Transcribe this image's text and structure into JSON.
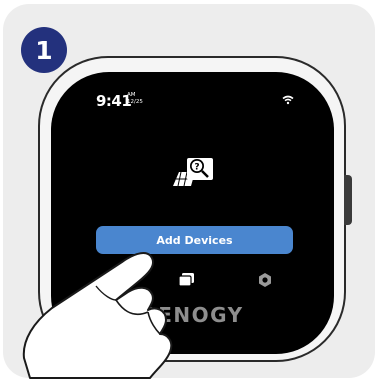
{
  "step": {
    "number": "1"
  },
  "status_bar": {
    "time": "9:41",
    "ampm": "AM",
    "date": "12/25",
    "wifi_icon": "wifi-icon"
  },
  "main": {
    "illustration_icon": "device-search-icon",
    "add_button_label": "Add Devices"
  },
  "nav": {
    "icons": [
      "devices-icon",
      "settings-hexagon-icon"
    ]
  },
  "brand": {
    "logo_text": "RENOGY"
  },
  "colors": {
    "badge": "#23317d",
    "button": "#4a86cf",
    "screen": "#000000",
    "card": "#ededed"
  }
}
